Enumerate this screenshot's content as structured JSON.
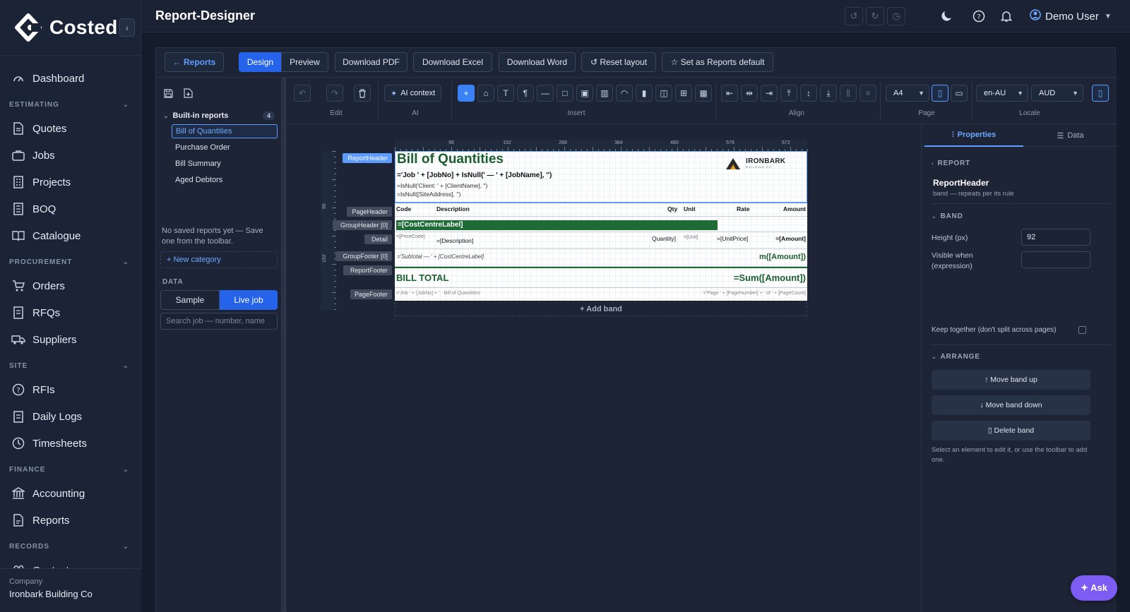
{
  "app": {
    "brand": "Costed",
    "page_title": "Report-Designer",
    "user": "Demo User"
  },
  "sidebar": {
    "dashboard": "Dashboard",
    "sections": [
      {
        "title": "ESTIMATING",
        "items": [
          "Quotes",
          "Jobs",
          "Projects",
          "BOQ",
          "Catalogue"
        ]
      },
      {
        "title": "PROCUREMENT",
        "items": [
          "Orders",
          "RFQs",
          "Suppliers"
        ]
      },
      {
        "title": "SITE",
        "items": [
          "RFIs",
          "Daily Logs",
          "Timesheets"
        ]
      },
      {
        "title": "FINANCE",
        "items": [
          "Accounting",
          "Reports"
        ]
      },
      {
        "title": "RECORDS",
        "items": [
          "Contacts"
        ]
      }
    ],
    "company_label": "Company",
    "company_name": "Ironbark Building Co"
  },
  "toolbar": {
    "reports_back": "← Reports",
    "design": "Design",
    "preview": "Preview",
    "download_pdf": "Download PDF",
    "download_excel": "Download Excel",
    "download_word": "Download Word",
    "reset_layout": "↺ Reset layout",
    "set_default": "☆ Set as Reports default"
  },
  "left_panel": {
    "builtin_title": "Built-in reports",
    "builtin_count": "4",
    "reports": [
      "Bill of Quantities",
      "Purchase Order",
      "Bill Summary",
      "Aged Debtors"
    ],
    "no_saved": "No saved reports yet — Save one from the toolbar.",
    "new_category": "+ New category",
    "data_label": "DATA",
    "sample": "Sample",
    "live_job": "Live job",
    "search_placeholder": "Search job — number, name"
  },
  "ribbon": {
    "ai_context": "AI context",
    "groups": {
      "edit": "Edit",
      "ai": "AI",
      "insert": "Insert",
      "align": "Align",
      "page": "Page",
      "locale": "Locale"
    },
    "page_size": "A4",
    "locale": "en-AU",
    "currency": "AUD"
  },
  "ruler": {
    "top_ticks": [
      "96",
      "192",
      "288",
      "384",
      "480",
      "576",
      "672"
    ],
    "left_ticks": [
      "96",
      "192"
    ]
  },
  "bands": {
    "report_header": "ReportHeader",
    "page_header": "PageHeader",
    "group_header": "GroupHeader [0]",
    "detail": "Detail",
    "group_footer": "GroupFooter [0]",
    "report_footer": "ReportFooter",
    "page_footer": "PageFooter"
  },
  "report": {
    "title": "Bill of Quantities",
    "job_expr": "='Job ' + [JobNo] + IsNull(' — ' + [JobName], '')",
    "client_expr": "=IsNull('Client: ' + [ClientName], '')",
    "site_expr": "=IsNull([SiteAddress], '')",
    "logo_name": "IRONBARK",
    "logo_sub": "BUILDING CO",
    "columns": {
      "code": "Code",
      "description": "Description",
      "qty": "Qty",
      "unit": "Unit",
      "rate": "Rate",
      "amount": "Amount"
    },
    "cost_centre": "=[CostCentreLabel]",
    "detail": {
      "code": "=[PriceCode]",
      "description": "=[Description]",
      "qty": "Quantity]",
      "unit": "=[Unit]",
      "rate": "=[UnitPrice]",
      "amount": "=[Amount]"
    },
    "subtotal_expr": "='Subtotal — ' + [CostCentreLabel]",
    "subtotal_sum": "m([Amount])",
    "bill_total": "BILL TOTAL",
    "bill_total_sum": "=Sum([Amount])",
    "footer_left": "='Job ' + [JobNo] + ' · Bill of Quantities'",
    "footer_right": "='Page ' + [PageNumber] + ' of ' + [PageCount]",
    "add_band": "+ Add band"
  },
  "properties": {
    "tab_properties": "Properties",
    "tab_data": "Data",
    "report_section": "REPORT",
    "band_name": "ReportHeader",
    "band_desc": "band — repeats per its rule",
    "band_section": "BAND",
    "height_label": "Height (px)",
    "height_value": "92",
    "visible_label_1": "Visible when",
    "visible_label_2": "(expression)",
    "keep_together": "Keep together (don't split across pages)",
    "arrange_section": "ARRANGE",
    "move_up": "↑ Move band up",
    "move_down": "↓ Move band down",
    "delete_band": "▯ Delete band",
    "hint": "Select an element to edit it, or use the toolbar to add one."
  },
  "ask": "✦ Ask",
  "colors": {
    "accent": "#2563eb",
    "brand_green": "#1f6b36",
    "ask": "#7c5cf2"
  }
}
